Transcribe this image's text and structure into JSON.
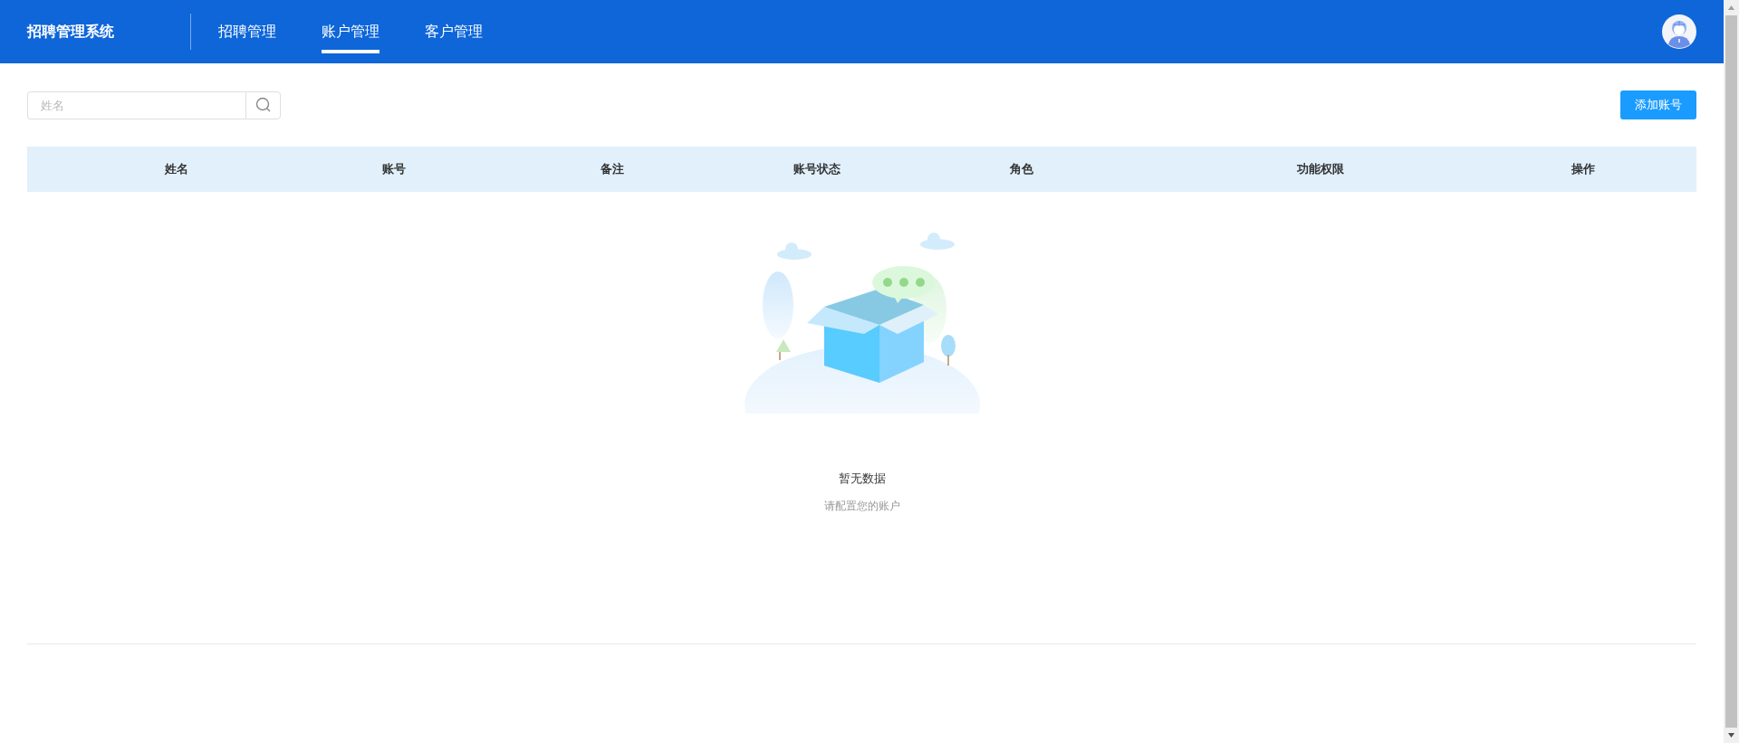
{
  "header": {
    "title": "招聘管理系统",
    "nav": [
      {
        "label": "招聘管理",
        "selected": false
      },
      {
        "label": "账户管理",
        "selected": true
      },
      {
        "label": "客户管理",
        "selected": false
      }
    ]
  },
  "search": {
    "placeholder": "姓名"
  },
  "add_button": "添加账号",
  "table": {
    "columns": [
      "姓名",
      "账号",
      "备注",
      "账号状态",
      "角色",
      "功能权限",
      "操作"
    ]
  },
  "empty": {
    "title": "暂无数据",
    "subtitle": "请配置您的账户"
  }
}
